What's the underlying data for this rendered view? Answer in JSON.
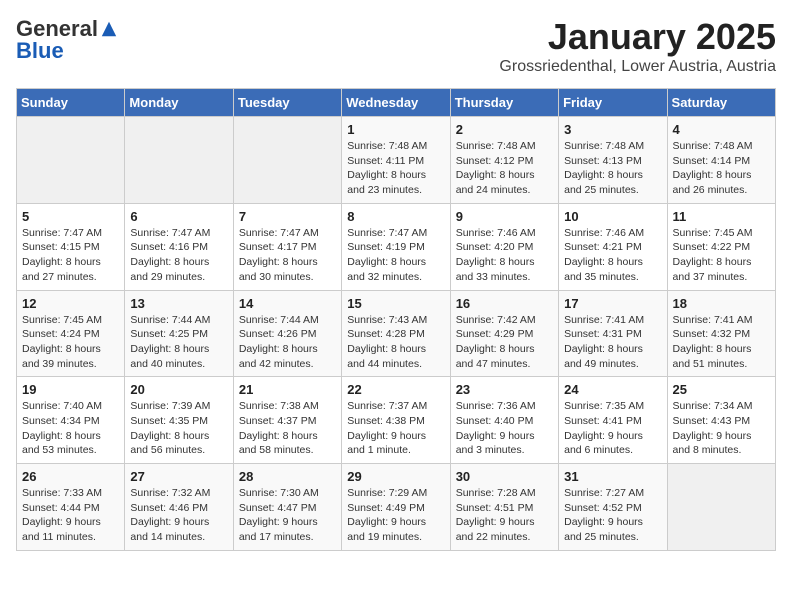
{
  "logo": {
    "general": "General",
    "blue": "Blue"
  },
  "header": {
    "month": "January 2025",
    "location": "Grossriedenthal, Lower Austria, Austria"
  },
  "weekdays": [
    "Sunday",
    "Monday",
    "Tuesday",
    "Wednesday",
    "Thursday",
    "Friday",
    "Saturday"
  ],
  "weeks": [
    [
      {
        "day": "",
        "sunrise": "",
        "sunset": "",
        "daylight": ""
      },
      {
        "day": "",
        "sunrise": "",
        "sunset": "",
        "daylight": ""
      },
      {
        "day": "",
        "sunrise": "",
        "sunset": "",
        "daylight": ""
      },
      {
        "day": "1",
        "sunrise": "Sunrise: 7:48 AM",
        "sunset": "Sunset: 4:11 PM",
        "daylight": "Daylight: 8 hours and 23 minutes."
      },
      {
        "day": "2",
        "sunrise": "Sunrise: 7:48 AM",
        "sunset": "Sunset: 4:12 PM",
        "daylight": "Daylight: 8 hours and 24 minutes."
      },
      {
        "day": "3",
        "sunrise": "Sunrise: 7:48 AM",
        "sunset": "Sunset: 4:13 PM",
        "daylight": "Daylight: 8 hours and 25 minutes."
      },
      {
        "day": "4",
        "sunrise": "Sunrise: 7:48 AM",
        "sunset": "Sunset: 4:14 PM",
        "daylight": "Daylight: 8 hours and 26 minutes."
      }
    ],
    [
      {
        "day": "5",
        "sunrise": "Sunrise: 7:47 AM",
        "sunset": "Sunset: 4:15 PM",
        "daylight": "Daylight: 8 hours and 27 minutes."
      },
      {
        "day": "6",
        "sunrise": "Sunrise: 7:47 AM",
        "sunset": "Sunset: 4:16 PM",
        "daylight": "Daylight: 8 hours and 29 minutes."
      },
      {
        "day": "7",
        "sunrise": "Sunrise: 7:47 AM",
        "sunset": "Sunset: 4:17 PM",
        "daylight": "Daylight: 8 hours and 30 minutes."
      },
      {
        "day": "8",
        "sunrise": "Sunrise: 7:47 AM",
        "sunset": "Sunset: 4:19 PM",
        "daylight": "Daylight: 8 hours and 32 minutes."
      },
      {
        "day": "9",
        "sunrise": "Sunrise: 7:46 AM",
        "sunset": "Sunset: 4:20 PM",
        "daylight": "Daylight: 8 hours and 33 minutes."
      },
      {
        "day": "10",
        "sunrise": "Sunrise: 7:46 AM",
        "sunset": "Sunset: 4:21 PM",
        "daylight": "Daylight: 8 hours and 35 minutes."
      },
      {
        "day": "11",
        "sunrise": "Sunrise: 7:45 AM",
        "sunset": "Sunset: 4:22 PM",
        "daylight": "Daylight: 8 hours and 37 minutes."
      }
    ],
    [
      {
        "day": "12",
        "sunrise": "Sunrise: 7:45 AM",
        "sunset": "Sunset: 4:24 PM",
        "daylight": "Daylight: 8 hours and 39 minutes."
      },
      {
        "day": "13",
        "sunrise": "Sunrise: 7:44 AM",
        "sunset": "Sunset: 4:25 PM",
        "daylight": "Daylight: 8 hours and 40 minutes."
      },
      {
        "day": "14",
        "sunrise": "Sunrise: 7:44 AM",
        "sunset": "Sunset: 4:26 PM",
        "daylight": "Daylight: 8 hours and 42 minutes."
      },
      {
        "day": "15",
        "sunrise": "Sunrise: 7:43 AM",
        "sunset": "Sunset: 4:28 PM",
        "daylight": "Daylight: 8 hours and 44 minutes."
      },
      {
        "day": "16",
        "sunrise": "Sunrise: 7:42 AM",
        "sunset": "Sunset: 4:29 PM",
        "daylight": "Daylight: 8 hours and 47 minutes."
      },
      {
        "day": "17",
        "sunrise": "Sunrise: 7:41 AM",
        "sunset": "Sunset: 4:31 PM",
        "daylight": "Daylight: 8 hours and 49 minutes."
      },
      {
        "day": "18",
        "sunrise": "Sunrise: 7:41 AM",
        "sunset": "Sunset: 4:32 PM",
        "daylight": "Daylight: 8 hours and 51 minutes."
      }
    ],
    [
      {
        "day": "19",
        "sunrise": "Sunrise: 7:40 AM",
        "sunset": "Sunset: 4:34 PM",
        "daylight": "Daylight: 8 hours and 53 minutes."
      },
      {
        "day": "20",
        "sunrise": "Sunrise: 7:39 AM",
        "sunset": "Sunset: 4:35 PM",
        "daylight": "Daylight: 8 hours and 56 minutes."
      },
      {
        "day": "21",
        "sunrise": "Sunrise: 7:38 AM",
        "sunset": "Sunset: 4:37 PM",
        "daylight": "Daylight: 8 hours and 58 minutes."
      },
      {
        "day": "22",
        "sunrise": "Sunrise: 7:37 AM",
        "sunset": "Sunset: 4:38 PM",
        "daylight": "Daylight: 9 hours and 1 minute."
      },
      {
        "day": "23",
        "sunrise": "Sunrise: 7:36 AM",
        "sunset": "Sunset: 4:40 PM",
        "daylight": "Daylight: 9 hours and 3 minutes."
      },
      {
        "day": "24",
        "sunrise": "Sunrise: 7:35 AM",
        "sunset": "Sunset: 4:41 PM",
        "daylight": "Daylight: 9 hours and 6 minutes."
      },
      {
        "day": "25",
        "sunrise": "Sunrise: 7:34 AM",
        "sunset": "Sunset: 4:43 PM",
        "daylight": "Daylight: 9 hours and 8 minutes."
      }
    ],
    [
      {
        "day": "26",
        "sunrise": "Sunrise: 7:33 AM",
        "sunset": "Sunset: 4:44 PM",
        "daylight": "Daylight: 9 hours and 11 minutes."
      },
      {
        "day": "27",
        "sunrise": "Sunrise: 7:32 AM",
        "sunset": "Sunset: 4:46 PM",
        "daylight": "Daylight: 9 hours and 14 minutes."
      },
      {
        "day": "28",
        "sunrise": "Sunrise: 7:30 AM",
        "sunset": "Sunset: 4:47 PM",
        "daylight": "Daylight: 9 hours and 17 minutes."
      },
      {
        "day": "29",
        "sunrise": "Sunrise: 7:29 AM",
        "sunset": "Sunset: 4:49 PM",
        "daylight": "Daylight: 9 hours and 19 minutes."
      },
      {
        "day": "30",
        "sunrise": "Sunrise: 7:28 AM",
        "sunset": "Sunset: 4:51 PM",
        "daylight": "Daylight: 9 hours and 22 minutes."
      },
      {
        "day": "31",
        "sunrise": "Sunrise: 7:27 AM",
        "sunset": "Sunset: 4:52 PM",
        "daylight": "Daylight: 9 hours and 25 minutes."
      },
      {
        "day": "",
        "sunrise": "",
        "sunset": "",
        "daylight": ""
      }
    ]
  ]
}
